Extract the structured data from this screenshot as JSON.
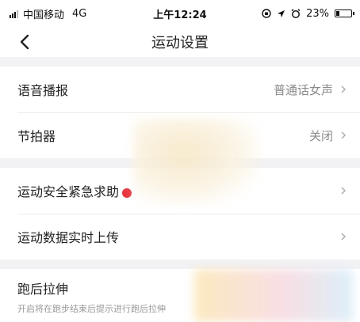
{
  "status_bar": {
    "carrier": "中国移动",
    "network": "4G",
    "time": "上午12:24",
    "battery": "23%",
    "battery_level": 0.23
  },
  "nav": {
    "title": "运动设置",
    "back_icon": "chevron-left-icon"
  },
  "settings": {
    "voice": {
      "label": "语音播报",
      "value": "普通话女声"
    },
    "metronome": {
      "label": "节拍器",
      "value": "关闭"
    },
    "emergency": {
      "label": "运动安全紧急求助"
    },
    "upload": {
      "label": "运动数据实时上传"
    },
    "stretch": {
      "label": "跑后拉伸",
      "description": "开启将在跑步结束后提示进行跑后拉伸"
    }
  },
  "colors": {
    "accent_red": "#e8353f",
    "divider": "#ececec",
    "section_bg": "#f2f2f4"
  }
}
